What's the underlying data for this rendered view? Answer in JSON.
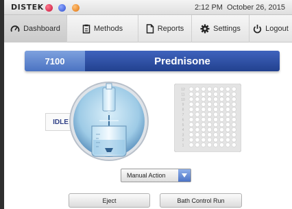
{
  "status_bar": {
    "logo": "DISTEK",
    "time": "2:12 PM",
    "date": "October 26, 2015"
  },
  "nav": {
    "tabs": [
      {
        "label": "Dashboard",
        "icon": "gauge-icon",
        "active": true
      },
      {
        "label": "Methods",
        "icon": "clipboard-icon",
        "active": false
      },
      {
        "label": "Reports",
        "icon": "document-icon",
        "active": false
      },
      {
        "label": "Settings",
        "icon": "gear-icon",
        "active": false
      },
      {
        "label": "Logout",
        "icon": "power-icon",
        "active": false
      }
    ]
  },
  "title_bar": {
    "instrument_number": "7100",
    "method_name": "Prednisone"
  },
  "vessel": {
    "status": "IDLE"
  },
  "sample_plate": {
    "row_labels": [
      "12",
      "11",
      "10",
      "9",
      "8",
      "7",
      "6",
      "5",
      "4",
      "3",
      "2",
      "1"
    ],
    "rows": 12,
    "columns": 8
  },
  "manual_action": {
    "selected": "Manual Action"
  },
  "buttons": {
    "eject": "Eject",
    "bath_control_run": "Bath Control Run"
  },
  "colors": {
    "title_light_blue": "#5a82d0",
    "title_dark_blue": "#2a4aa0",
    "status_red": "#e0284e",
    "status_blue": "#4466e0",
    "status_orange": "#f08a1c"
  }
}
